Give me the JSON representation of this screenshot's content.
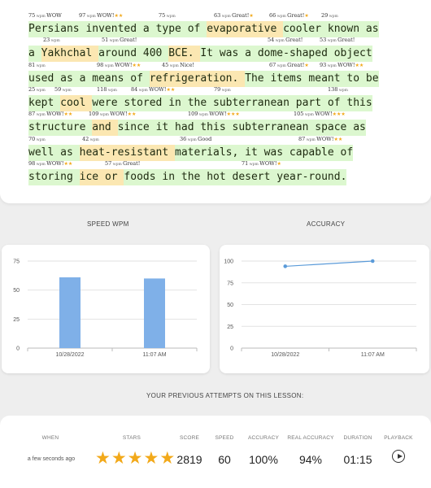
{
  "text_lines": [
    {
      "words": [
        {
          "t": "Persians "
        },
        {
          "t": "invented "
        },
        {
          "t": "a "
        },
        {
          "t": "type "
        },
        {
          "t": "of "
        },
        {
          "t": "evaporative "
        },
        {
          "t": "cooler "
        },
        {
          "t": "known "
        },
        {
          "t": "as"
        }
      ],
      "notes": [
        {
          "wpm": "75",
          "label": "WOW",
          "stars": ""
        },
        {
          "wpm": "97",
          "label": "WOW!",
          "stars": "★★"
        },
        {
          "wpm": "75",
          "label": "",
          "stars": ""
        },
        {
          "wpm": "63",
          "label": "Great!",
          "stars": "★"
        },
        {
          "wpm": "66",
          "label": "Great!",
          "stars": "★"
        },
        {
          "wpm": "29",
          "label": "",
          "stars": ""
        }
      ]
    },
    {
      "words": [
        {
          "t": "a "
        },
        {
          "t": "Yakhchal "
        },
        {
          "t": "around "
        },
        {
          "t": "400 "
        },
        {
          "t": "BCE. "
        },
        {
          "t": "It "
        },
        {
          "t": "was "
        },
        {
          "t": "a "
        },
        {
          "t": "dome-shaped "
        },
        {
          "t": "object"
        }
      ],
      "notes": [
        {
          "wpm": "23",
          "label": "",
          "stars": ""
        },
        {
          "wpm": "51",
          "label": "Great!",
          "stars": ""
        },
        {
          "wpm": "54",
          "label": "Great!",
          "stars": ""
        },
        {
          "wpm": "53",
          "label": "Great!",
          "stars": ""
        }
      ]
    },
    {
      "words": [
        {
          "t": "used "
        },
        {
          "t": "as "
        },
        {
          "t": "a "
        },
        {
          "t": "means "
        },
        {
          "t": "of "
        },
        {
          "t": "refrigeration. "
        },
        {
          "t": "The "
        },
        {
          "t": "items "
        },
        {
          "t": "meant "
        },
        {
          "t": "to "
        },
        {
          "t": "be"
        }
      ],
      "notes": [
        {
          "wpm": "81",
          "label": "",
          "stars": ""
        },
        {
          "wpm": "98",
          "label": "WOW!",
          "stars": "★★"
        },
        {
          "wpm": "45",
          "label": "Nice!",
          "stars": ""
        },
        {
          "wpm": "67",
          "label": "Great!",
          "stars": "★"
        },
        {
          "wpm": "93",
          "label": "WOW!",
          "stars": "★★"
        }
      ]
    },
    {
      "words": [
        {
          "t": "kept "
        },
        {
          "t": "cool "
        },
        {
          "t": "were "
        },
        {
          "t": "stored "
        },
        {
          "t": "in "
        },
        {
          "t": "the "
        },
        {
          "t": "subterranean "
        },
        {
          "t": "part "
        },
        {
          "t": "of "
        },
        {
          "t": "this"
        }
      ],
      "notes": [
        {
          "wpm": "25",
          "label": "",
          "stars": ""
        },
        {
          "wpm": "59",
          "label": "",
          "stars": ""
        },
        {
          "wpm": "118",
          "label": "",
          "stars": ""
        },
        {
          "wpm": "84",
          "label": "WOW!",
          "stars": "★★"
        },
        {
          "wpm": "79",
          "label": "",
          "stars": ""
        },
        {
          "wpm": "138",
          "label": "",
          "stars": ""
        }
      ]
    },
    {
      "words": [
        {
          "t": "structure "
        },
        {
          "t": "and "
        },
        {
          "t": "since "
        },
        {
          "t": "it "
        },
        {
          "t": "had "
        },
        {
          "t": "this "
        },
        {
          "t": "subterranean "
        },
        {
          "t": "space "
        },
        {
          "t": "as"
        }
      ],
      "notes": [
        {
          "wpm": "87",
          "label": "WOW!",
          "stars": "★★"
        },
        {
          "wpm": "109",
          "label": "WOW!",
          "stars": "★★"
        },
        {
          "wpm": "109",
          "label": "WOW!",
          "stars": "★★★"
        },
        {
          "wpm": "105",
          "label": "WOW!",
          "stars": "★★★"
        }
      ]
    },
    {
      "words": [
        {
          "t": "well "
        },
        {
          "t": "as "
        },
        {
          "t": "heat-resistant "
        },
        {
          "t": "materials, "
        },
        {
          "t": "it "
        },
        {
          "t": "was "
        },
        {
          "t": "capable "
        },
        {
          "t": "of"
        }
      ],
      "notes": [
        {
          "wpm": "70",
          "label": "",
          "stars": ""
        },
        {
          "wpm": "42",
          "label": "",
          "stars": ""
        },
        {
          "wpm": "36",
          "label": "Good",
          "stars": ""
        },
        {
          "wpm": "87",
          "label": "WOW!",
          "stars": "★★"
        }
      ]
    },
    {
      "words": [
        {
          "t": "storing "
        },
        {
          "t": "ice "
        },
        {
          "t": "or "
        },
        {
          "t": "foods "
        },
        {
          "t": "in "
        },
        {
          "t": "the "
        },
        {
          "t": "hot "
        },
        {
          "t": "desert "
        },
        {
          "t": "year-round."
        }
      ],
      "notes": [
        {
          "wpm": "98",
          "label": "WOW!",
          "stars": "★★"
        },
        {
          "wpm": "57",
          "label": "Great!",
          "stars": ""
        },
        {
          "wpm": "71",
          "label": "WOW!",
          "stars": "★"
        }
      ]
    }
  ],
  "sections": {
    "speed_title": "SPEED WPM",
    "accuracy_title": "ACCURACY",
    "attempts_title": "YOUR PREVIOUS ATTEMPTS ON THIS LESSON:"
  },
  "chart_data": [
    {
      "type": "bar",
      "title": "SPEED WPM",
      "categories": [
        "10/28/2022",
        "11:07 AM"
      ],
      "values": [
        61,
        60
      ],
      "ylim": [
        0,
        75
      ],
      "yticks": [
        0,
        25,
        50,
        75
      ],
      "grid": true,
      "color": "#7fb0e8"
    },
    {
      "type": "line",
      "title": "ACCURACY",
      "categories": [
        "10/28/2022",
        "11:07 AM"
      ],
      "values": [
        94,
        100
      ],
      "ylim": [
        0,
        100
      ],
      "yticks": [
        0,
        25,
        50,
        75,
        100
      ],
      "grid": true,
      "color": "#5b9bd9"
    }
  ],
  "attempts": {
    "headers": {
      "when": "WHEN",
      "stars": "STARS",
      "score": "SCORE",
      "speed": "SPEED",
      "accuracy": "ACCURACY",
      "real_accuracy": "REAL ACCURACY",
      "duration": "DURATION",
      "playback": "PLAYBACK"
    },
    "row": {
      "when": "a few seconds ago",
      "stars": 5,
      "score": "2819",
      "speed": "60",
      "accuracy": "100%",
      "real_accuracy": "94%",
      "duration": "01:15",
      "playback_icon": "play-circle-icon"
    }
  },
  "colors": {
    "word_ok": "#dcf7cf",
    "word_error": "#fbe7b2",
    "star": "#f2a91a"
  }
}
